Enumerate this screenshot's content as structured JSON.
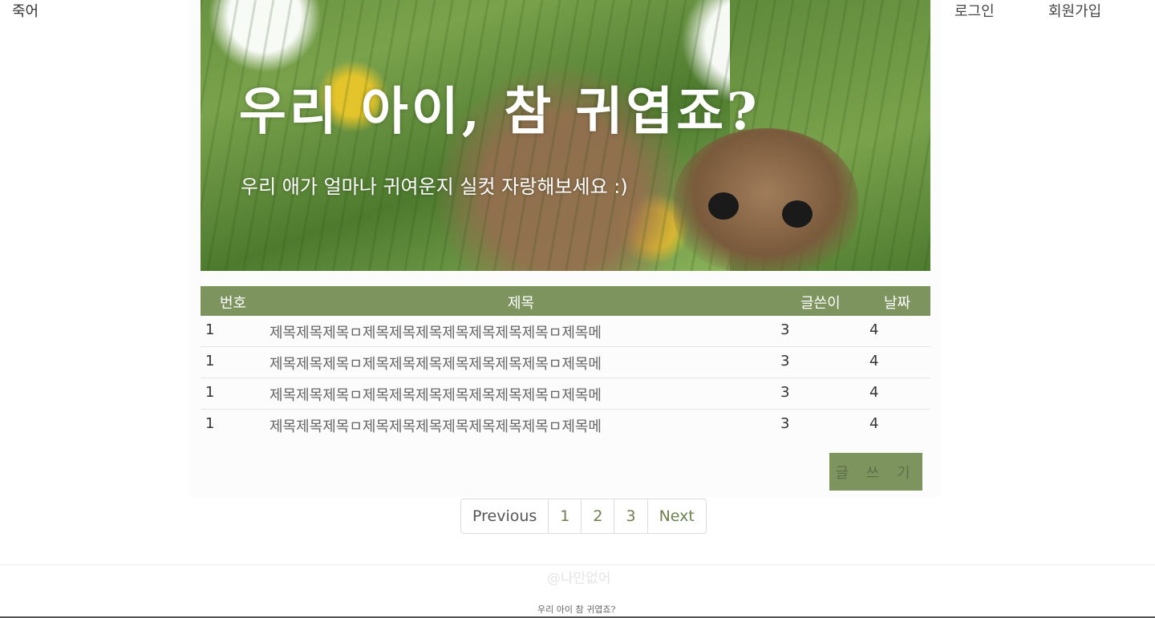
{
  "header": {
    "logo": "죽어",
    "login": "로그인",
    "signup": "회원가입"
  },
  "hero": {
    "title": "우리 아이, 참 귀엽죠?",
    "subtitle": "우리 애가 얼마나 귀여운지 실컷 자랑해보세요 :)"
  },
  "board": {
    "columns": [
      "번호",
      "제목",
      "글쓴이",
      "날짜"
    ],
    "rows": [
      {
        "num": "1",
        "title": "제목제목제목ㅁ제목제목제목제목제목제목제목ㅁ제목메",
        "writer": "3",
        "date": "4"
      },
      {
        "num": "1",
        "title": "제목제목제목ㅁ제목제목제목제목제목제목제목ㅁ제목메",
        "writer": "3",
        "date": "4"
      },
      {
        "num": "1",
        "title": "제목제목제목ㅁ제목제목제목제목제목제목제목ㅁ제목메",
        "writer": "3",
        "date": "4"
      },
      {
        "num": "1",
        "title": "제목제목제목ㅁ제목제목제목제목제목제목제목ㅁ제목메",
        "writer": "3",
        "date": "4"
      }
    ],
    "write_button": "글 쓰 기"
  },
  "pagination": {
    "prev": "Previous",
    "pages": [
      "1",
      "2",
      "3"
    ],
    "next": "Next"
  },
  "footer": {
    "copyright": "@나만없어",
    "logo_text": "우리 아이 참 귀엽죠?"
  },
  "colors": {
    "accent": "#7d945f"
  }
}
